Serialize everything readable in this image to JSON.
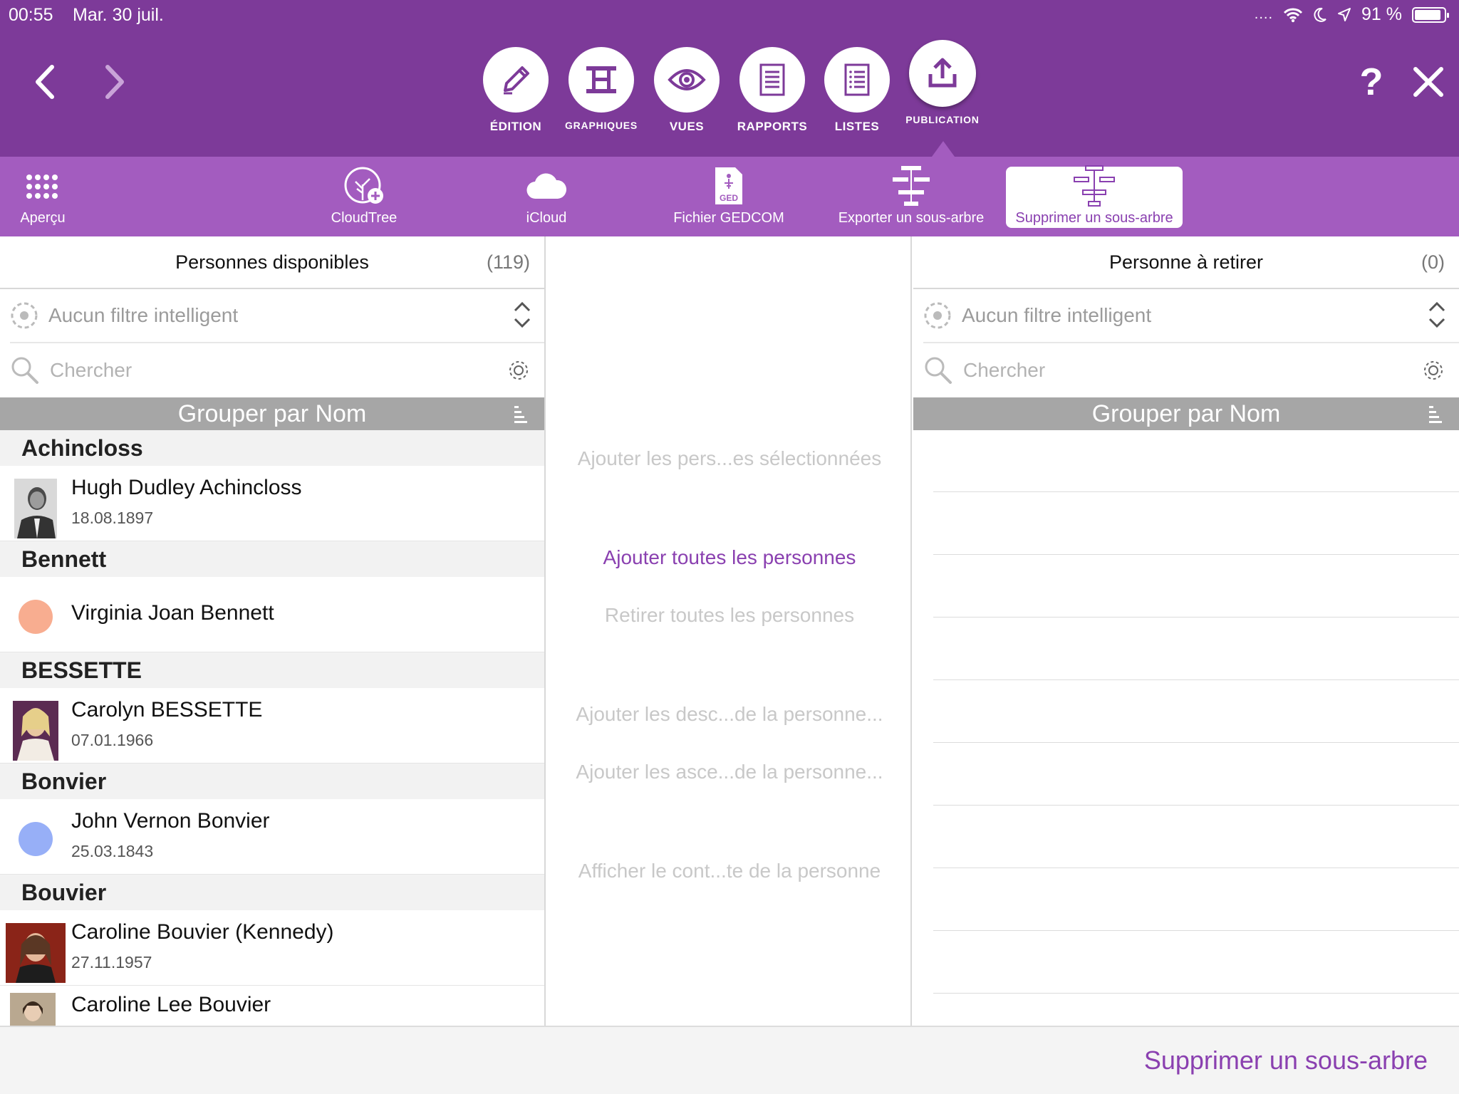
{
  "status": {
    "time": "00:55",
    "date": "Mar. 30 juil.",
    "battery": "91 %",
    "battery_level": 0.91
  },
  "nav": {
    "back_icon": "chevron-left-icon",
    "forward_icon": "chevron-right-icon",
    "help_label": "?",
    "close_icon": "close-icon"
  },
  "modules": [
    {
      "label": "ÉDITION",
      "icon": "pencil-icon"
    },
    {
      "label": "GRAPHIQUES",
      "icon": "chart-tree-icon"
    },
    {
      "label": "VUES",
      "icon": "eye-icon"
    },
    {
      "label": "RAPPORTS",
      "icon": "report-icon"
    },
    {
      "label": "LISTES",
      "icon": "list-icon"
    },
    {
      "label": "PUBLICATION",
      "icon": "upload-icon",
      "active": true
    }
  ],
  "subtoolbar": [
    {
      "label": "Aperçu",
      "icon": "grid-icon"
    },
    {
      "label": "CloudTree",
      "icon": "cloudtree-icon"
    },
    {
      "label": "iCloud",
      "icon": "cloud-icon"
    },
    {
      "label": "Fichier GEDCOM",
      "icon": "gedcom-file-icon",
      "badge": "GED"
    },
    {
      "label": "Exporter un sous-arbre",
      "icon": "export-subtree-icon"
    },
    {
      "label": "Supprimer un sous-arbre",
      "icon": "delete-subtree-icon",
      "selected": true
    }
  ],
  "left_panel": {
    "title": "Personnes disponibles",
    "count": "(119)",
    "filter_placeholder": "Aucun filtre intelligent",
    "search_placeholder": "Chercher",
    "group_label": "Grouper par Nom",
    "sections": [
      {
        "header": "Achincloss",
        "people": [
          {
            "name": "Hugh Dudley Achincloss",
            "date": "18.08.1897",
            "avatar": "photo"
          }
        ]
      },
      {
        "header": "Bennett",
        "people": [
          {
            "name": "Virginia Joan Bennett",
            "date": "",
            "avatar": "dot",
            "color": "#f8ad90"
          }
        ]
      },
      {
        "header": "BESSETTE",
        "people": [
          {
            "name": "Carolyn BESSETTE",
            "date": "07.01.1966",
            "avatar": "photo"
          }
        ]
      },
      {
        "header": "Bonvier",
        "people": [
          {
            "name": "John Vernon Bonvier",
            "date": "25.03.1843",
            "avatar": "dot",
            "color": "#97aff7"
          }
        ]
      },
      {
        "header": "Bouvier",
        "people": [
          {
            "name": "Caroline Bouvier (Kennedy)",
            "date": "27.11.1957",
            "avatar": "photo"
          },
          {
            "name": "Caroline Lee Bouvier",
            "date": "",
            "avatar": "photo"
          }
        ]
      }
    ]
  },
  "middle_panel": {
    "actions": [
      {
        "label": "Ajouter les pers...es sélectionnées",
        "enabled": false
      },
      {
        "label": "Ajouter toutes les personnes",
        "enabled": true
      },
      {
        "label": "Retirer toutes les personnes",
        "enabled": false
      },
      {
        "label": "Ajouter les desc...de la personne...",
        "enabled": false
      },
      {
        "label": "Ajouter les asce...de la personne...",
        "enabled": false
      },
      {
        "label": "Afficher le cont...te de la personne",
        "enabled": false
      }
    ]
  },
  "right_panel": {
    "title": "Personne à retirer",
    "count": "(0)",
    "filter_placeholder": "Aucun filtre intelligent",
    "search_placeholder": "Chercher",
    "group_label": "Grouper par Nom"
  },
  "bottom": {
    "action_label": "Supprimer un sous-arbre"
  },
  "colors": {
    "primary": "#7d3a99",
    "secondary": "#a35cbf",
    "accent_text": "#8a40b0",
    "disabled_text": "#c8c8c8",
    "group_bar": "#a6a6a6"
  }
}
